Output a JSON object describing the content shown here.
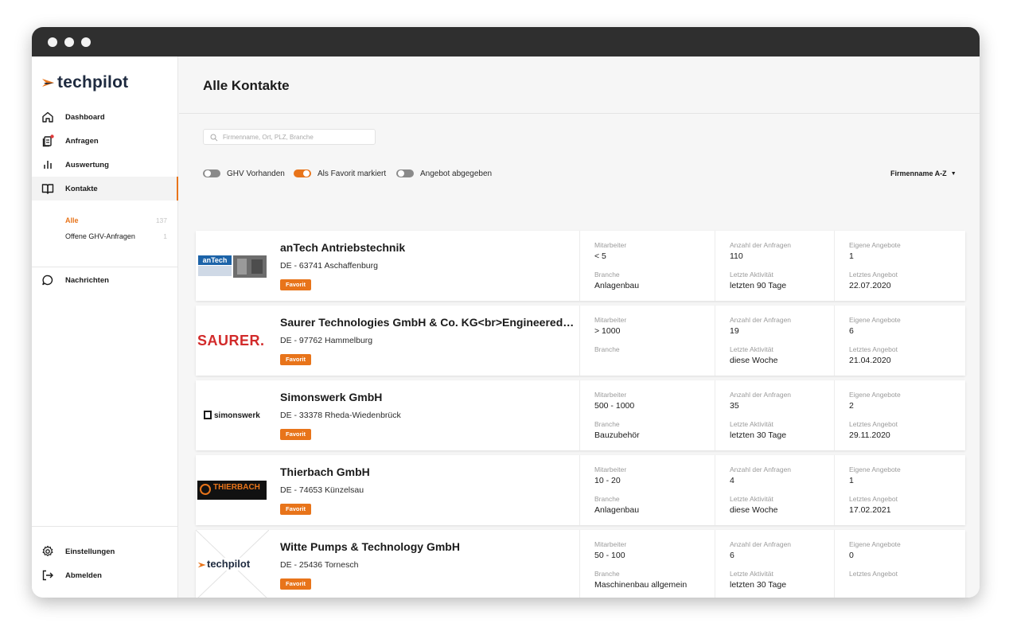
{
  "app": {
    "logo_text": "techpilot",
    "page_title": "Alle Kontakte"
  },
  "sidebar": {
    "nav": [
      {
        "label": "Dashboard",
        "icon": "home-icon"
      },
      {
        "label": "Anfragen",
        "icon": "documents-icon"
      },
      {
        "label": "Auswertung",
        "icon": "bar-chart-icon"
      },
      {
        "label": "Kontakte",
        "icon": "book-icon"
      }
    ],
    "sub": [
      {
        "label": "Alle",
        "count": "137"
      },
      {
        "label": "Offene GHV-Anfragen",
        "count": "1"
      }
    ],
    "messages": {
      "label": "Nachrichten",
      "icon": "chat-bubble-icon"
    },
    "bottom": [
      {
        "label": "Einstellungen",
        "icon": "gear-icon"
      },
      {
        "label": "Abmelden",
        "icon": "logout-icon"
      }
    ]
  },
  "search": {
    "placeholder": "Firmenname, Ort, PLZ, Branche",
    "value": ""
  },
  "filters": [
    {
      "label": "GHV Vorhanden",
      "on": false
    },
    {
      "label": "Als Favorit markiert",
      "on": true
    },
    {
      "label": "Angebot abgegeben",
      "on": false
    }
  ],
  "sort": {
    "label": "Firmenname A-Z"
  },
  "labels": {
    "mitarbeiter": "Mitarbeiter",
    "branche": "Branche",
    "anfragen": "Anzahl der Anfragen",
    "aktivitaet": "Letzte Aktivität",
    "angebote": "Eigene Angebote",
    "letztes_angebot": "Letztes Angebot"
  },
  "contacts": [
    {
      "name": "anTech Antriebstechnik",
      "address": "DE - 63741 Aschaffenburg",
      "badge": "Favorit",
      "logo_text": "anTech",
      "mitarbeiter": "< 5",
      "branche": "Anlagenbau",
      "anfragen": "110",
      "aktivitaet": "letzten 90 Tage",
      "angebote": "1",
      "letztes_angebot": "22.07.2020"
    },
    {
      "name": "Saurer Technologies GmbH & Co. KG<br>Engineered Textile Solutions",
      "address": "DE - 97762 Hammelburg",
      "badge": "Favorit",
      "logo_text": "SAURER.",
      "mitarbeiter": "> 1000",
      "branche": "",
      "anfragen": "19",
      "aktivitaet": "diese Woche",
      "angebote": "6",
      "letztes_angebot": "21.04.2020"
    },
    {
      "name": "Simonswerk GmbH",
      "address": "DE - 33378 Rheda-Wiedenbrück",
      "badge": "Favorit",
      "logo_text": "simonswerk",
      "mitarbeiter": "500 - 1000",
      "branche": "Bauzubehör",
      "anfragen": "35",
      "aktivitaet": "letzten 30 Tage",
      "angebote": "2",
      "letztes_angebot": "29.11.2020"
    },
    {
      "name": "Thierbach GmbH",
      "address": "DE - 74653 Künzelsau",
      "badge": "Favorit",
      "logo_text": "THIERBACH",
      "mitarbeiter": "10 - 20",
      "branche": "Anlagenbau",
      "anfragen": "4",
      "aktivitaet": "diese Woche",
      "angebote": "1",
      "letztes_angebot": "17.02.2021"
    },
    {
      "name": "Witte Pumps & Technology GmbH",
      "address": "DE - 25436 Tornesch",
      "badge": "Favorit",
      "logo_text": "techpilot",
      "mitarbeiter": "50 - 100",
      "branche": "Maschinenbau allgemein",
      "anfragen": "6",
      "aktivitaet": "letzten 30 Tage",
      "angebote": "0",
      "letztes_angebot": ""
    }
  ],
  "colors": {
    "accent": "#e8741a",
    "dark": "#1e2a3f",
    "titlebar": "#2f2f2f"
  }
}
